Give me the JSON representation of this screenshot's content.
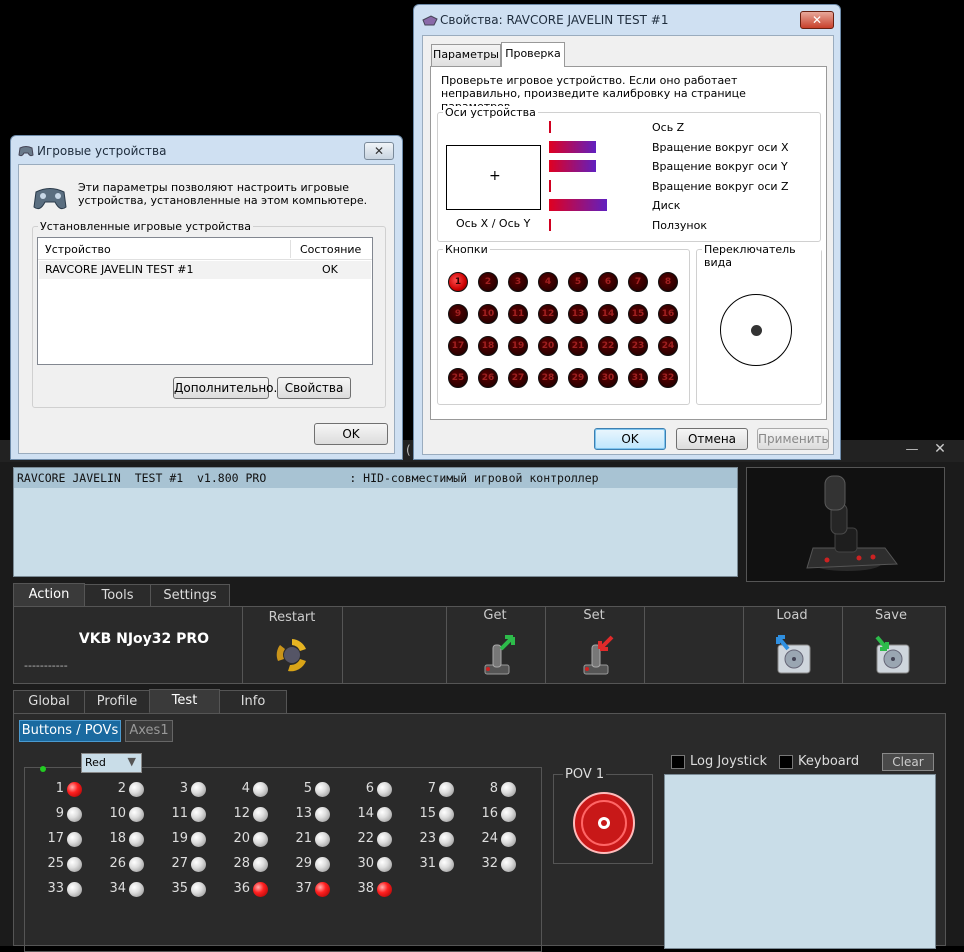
{
  "vkb": {
    "device_row": "RAVCORE JAVELIN  TEST #1  v1.800 PRO            : HID-совместимый игровой контроллер",
    "main_tabs": [
      {
        "label": "Action"
      },
      {
        "label": "Tools"
      },
      {
        "label": "Settings"
      }
    ],
    "brand": "VKB NJoy32 PRO",
    "brand_sub": "-----------",
    "tools": [
      {
        "label": "Restart"
      },
      {
        "label": "Get"
      },
      {
        "label": "Set"
      },
      {
        "label": "Load"
      },
      {
        "label": "Save"
      }
    ],
    "sub_tabs": [
      {
        "label": "Global"
      },
      {
        "label": "Profile"
      },
      {
        "label": "Test"
      },
      {
        "label": "Info"
      }
    ],
    "test_tabs": [
      {
        "label": "Buttons / POVs"
      },
      {
        "label": "Axes1"
      }
    ],
    "color_select": "Red",
    "pov_label": "POV 1",
    "log_joystick": "Log Joystick",
    "keyboard": "Keyboard",
    "clear": "Clear",
    "buttons": [
      {
        "n": "1",
        "on": true
      },
      {
        "n": "2",
        "on": false
      },
      {
        "n": "3",
        "on": false
      },
      {
        "n": "4",
        "on": false
      },
      {
        "n": "5",
        "on": false
      },
      {
        "n": "6",
        "on": false
      },
      {
        "n": "7",
        "on": false
      },
      {
        "n": "8",
        "on": false
      },
      {
        "n": "9",
        "on": false
      },
      {
        "n": "10",
        "on": false
      },
      {
        "n": "11",
        "on": false
      },
      {
        "n": "12",
        "on": false
      },
      {
        "n": "13",
        "on": false
      },
      {
        "n": "14",
        "on": false
      },
      {
        "n": "15",
        "on": false
      },
      {
        "n": "16",
        "on": false
      },
      {
        "n": "17",
        "on": false
      },
      {
        "n": "18",
        "on": false
      },
      {
        "n": "19",
        "on": false
      },
      {
        "n": "20",
        "on": false
      },
      {
        "n": "21",
        "on": false
      },
      {
        "n": "22",
        "on": false
      },
      {
        "n": "23",
        "on": false
      },
      {
        "n": "24",
        "on": false
      },
      {
        "n": "25",
        "on": false
      },
      {
        "n": "26",
        "on": false
      },
      {
        "n": "27",
        "on": false
      },
      {
        "n": "28",
        "on": false
      },
      {
        "n": "29",
        "on": false
      },
      {
        "n": "30",
        "on": false
      },
      {
        "n": "31",
        "on": false
      },
      {
        "n": "32",
        "on": false
      },
      {
        "n": "33",
        "on": false
      },
      {
        "n": "34",
        "on": false
      },
      {
        "n": "35",
        "on": false
      },
      {
        "n": "36",
        "on": true
      },
      {
        "n": "37",
        "on": true
      },
      {
        "n": "38",
        "on": true
      }
    ]
  },
  "gd": {
    "title": "Игровые устройства",
    "desc": "Эти параметры позволяют настроить игровые устройства, установленные на этом компьютере.",
    "group_label": "Установленные игровые устройства",
    "col_device": "Устройство",
    "col_status": "Состояние",
    "row_device": "RAVCORE JAVELIN  TEST #1",
    "row_status": "OK",
    "btn_advanced": "Дополнительно...",
    "btn_properties": "Свойства",
    "btn_ok": "OK"
  },
  "props": {
    "title": "Свойства: RAVCORE JAVELIN  TEST #1",
    "tabs": [
      {
        "label": "Параметры"
      },
      {
        "label": "Проверка"
      }
    ],
    "desc": "Проверьте игровое устройство. Если оно работает неправильно, произведите калибровку на странице параметров.",
    "axes_group": "Оси устройства",
    "xy_label": "Ось X / Ось Y",
    "axes": [
      {
        "label": "Ось Z",
        "value": 0
      },
      {
        "label": "Вращение вокруг оси X",
        "value": 0.47
      },
      {
        "label": "Вращение вокруг оси Y",
        "value": 0.47
      },
      {
        "label": "Вращение вокруг оси Z",
        "value": 0
      },
      {
        "label": "Диск",
        "value": 0.58
      },
      {
        "label": "Ползунок",
        "value": 0
      }
    ],
    "buttons_group": "Кнопки",
    "buttons": [
      "1",
      "2",
      "3",
      "4",
      "5",
      "6",
      "7",
      "8",
      "9",
      "10",
      "11",
      "12",
      "13",
      "14",
      "15",
      "16",
      "17",
      "18",
      "19",
      "20",
      "21",
      "22",
      "23",
      "24",
      "25",
      "26",
      "27",
      "28",
      "29",
      "30",
      "31",
      "32"
    ],
    "pressed_buttons": [
      "1"
    ],
    "pov_group": "Переключатель вида",
    "btn_ok": "OK",
    "btn_cancel": "Отмена",
    "btn_apply": "Применить"
  }
}
